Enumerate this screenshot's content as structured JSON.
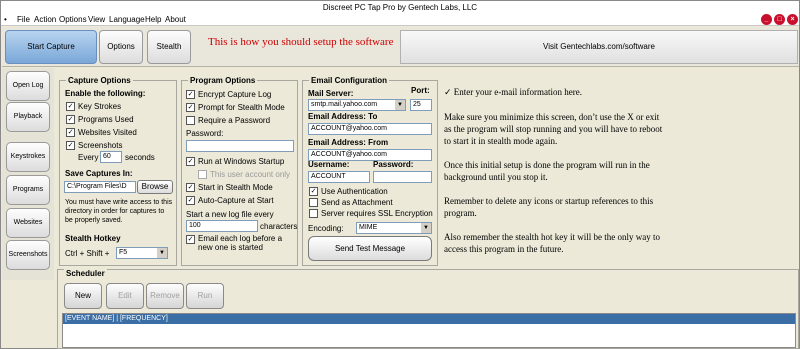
{
  "window": {
    "title": "Discreet PC Tap Pro by Gentech Labs, LLC"
  },
  "menu": {
    "items": [
      "File",
      "Action",
      "Options",
      "View",
      "Language",
      "Help",
      "About"
    ]
  },
  "controls": {
    "min": "_",
    "max": "□",
    "close": "×"
  },
  "toolbar": {
    "start_capture": "Start Capture",
    "options": "Options",
    "stealth": "Stealth",
    "message": "This is how you should setup the software",
    "visit": "Visit Gentechlabs.com/software"
  },
  "nav": {
    "open_log": "Open Log",
    "playback": "Playback",
    "keystrokes": "Keystrokes",
    "programs": "Programs",
    "websites": "Websites",
    "screenshots": "Screenshots"
  },
  "capture": {
    "title": "Capture Options",
    "enable_label": "Enable the following:",
    "key_strokes": "Key Strokes",
    "programs_used": "Programs Used",
    "websites_visited": "Websites Visited",
    "screenshots": "Screenshots",
    "every": "Every",
    "seconds_value": "60",
    "seconds": "seconds",
    "save_label": "Save Captures In:",
    "save_path": "C:\\Program Files\\D",
    "browse": "Browse",
    "write_access_note": "You must have write access to this directory in order for captures to be properly saved.",
    "hotkey_label": "Stealth Hotkey",
    "hotkey_prefix": "Ctrl + Shift +",
    "hotkey_value": "F5"
  },
  "program": {
    "title": "Program Options",
    "encrypt": "Encrypt Capture Log",
    "prompt_stealth": "Prompt for Stealth Mode",
    "require_password": "Require a Password",
    "password_label": "Password:",
    "run_startup": "Run at Windows Startup",
    "this_user_only": "This user account only",
    "start_stealth": "Start in Stealth Mode",
    "auto_capture": "Auto-Capture at Start",
    "new_log_label": "Start a new log file every",
    "new_log_value": "100",
    "characters": "characters",
    "email_log": "Email each log before a new one is started"
  },
  "email": {
    "title": "Email Configuration",
    "mail_server_label": "Mail Server:",
    "port_label": "Port:",
    "mail_server": "smtp.mail.yahoo.com",
    "port": "25",
    "to_label": "Email Address: To",
    "to_value": "ACCOUNT@yahoo.com",
    "from_label": "Email Address: From",
    "from_value": "ACCOUNT@yahoo.com",
    "username_label": "Username:",
    "password_label": "Password:",
    "username": "ACCOUNT",
    "use_auth": "Use Authentication",
    "send_attachment": "Send as Attachment",
    "ssl": "Server requires SSL Encryption",
    "encoding_label": "Encoding:",
    "encoding": "MIME",
    "send_test": "Send Test Message"
  },
  "notes": {
    "p1": "✓ Enter your e-mail information here.",
    "p2": "Make sure you minimize this screen, don’t use the X or exit as the program will stop running and you will have to reboot to start it in stealth mode again.",
    "p3": "Once this initial setup is done the program will run in the background until you stop it.",
    "p4": "Remember to delete any icons or startup references to this program.",
    "p5": "Also remember the stealth hot key it will be the only way to access this program in the future."
  },
  "scheduler": {
    "title": "Scheduler",
    "new": "New",
    "edit": "Edit",
    "remove": "Remove",
    "run": "Run",
    "header": "[EVENT NAME]      | [FREQUENCY]"
  }
}
